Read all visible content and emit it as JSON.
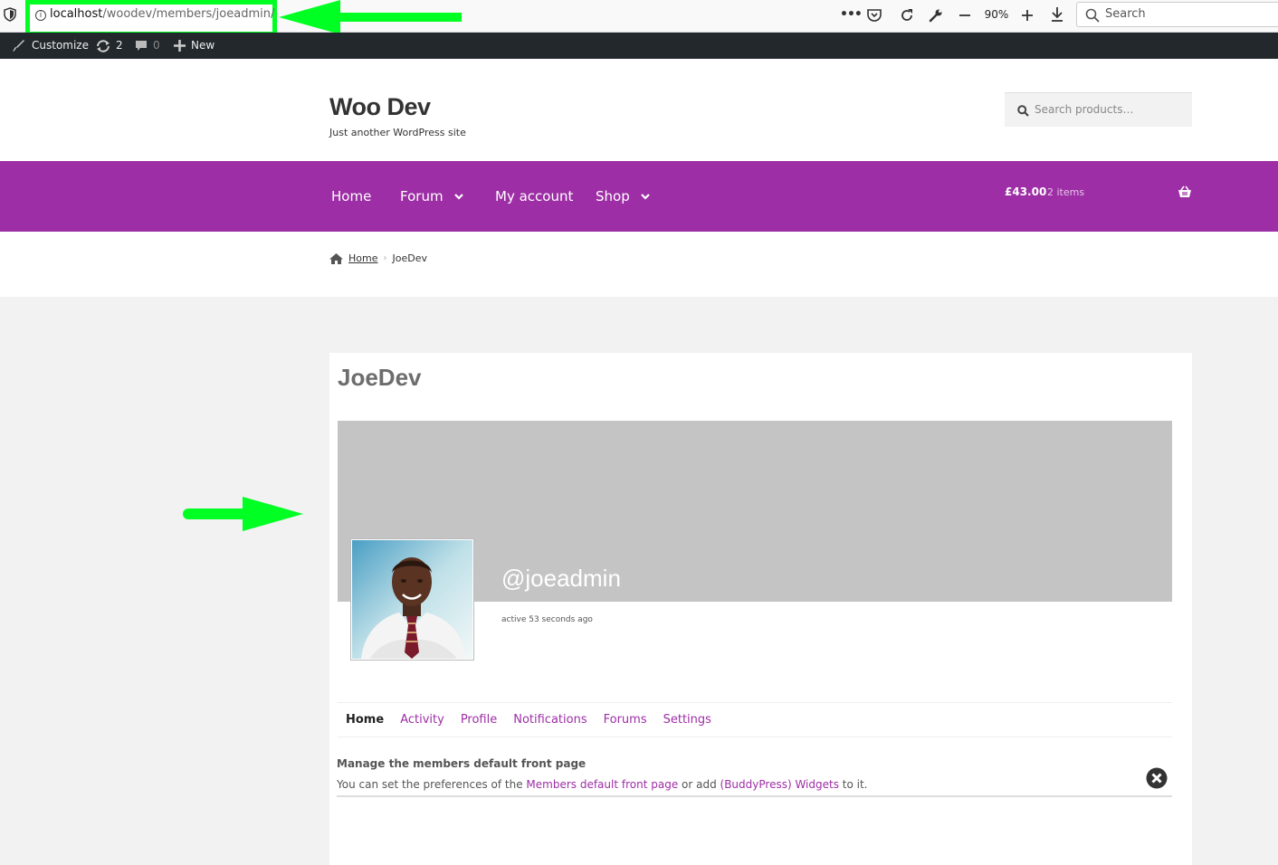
{
  "browser": {
    "url_host": "localhost",
    "url_path": "/woodev/members/joeadmin/",
    "zoom": "90%",
    "search_placeholder": "Search"
  },
  "adminbar": {
    "customize": "Customize",
    "updates": "2",
    "comments": "0",
    "new": "New"
  },
  "site": {
    "title": "Woo Dev",
    "description": "Just another WordPress site",
    "search_placeholder": "Search products…"
  },
  "nav": {
    "items": [
      "Home",
      "Forum",
      "My account",
      "Shop"
    ],
    "cart_total": "£43.00",
    "cart_count": "2 items"
  },
  "breadcrumb": {
    "home": "Home",
    "current": "JoeDev"
  },
  "member": {
    "title": "JoeDev",
    "handle": "@joeadmin",
    "last_active": "active 53 seconds ago"
  },
  "subnav": {
    "items": [
      "Home",
      "Activity",
      "Profile",
      "Notifications",
      "Forums",
      "Settings"
    ]
  },
  "notice": {
    "title": "Manage the members default front page",
    "text_1": "You can set the preferences of the ",
    "link_1": "Members default front page",
    "text_2": " or add ",
    "link_2": "(BuddyPress) Widgets",
    "text_3": " to it."
  },
  "colors": {
    "nav_purple": "#9d2ea5",
    "annotation_green": "#00ff22",
    "admin_bar": "#23282d"
  }
}
